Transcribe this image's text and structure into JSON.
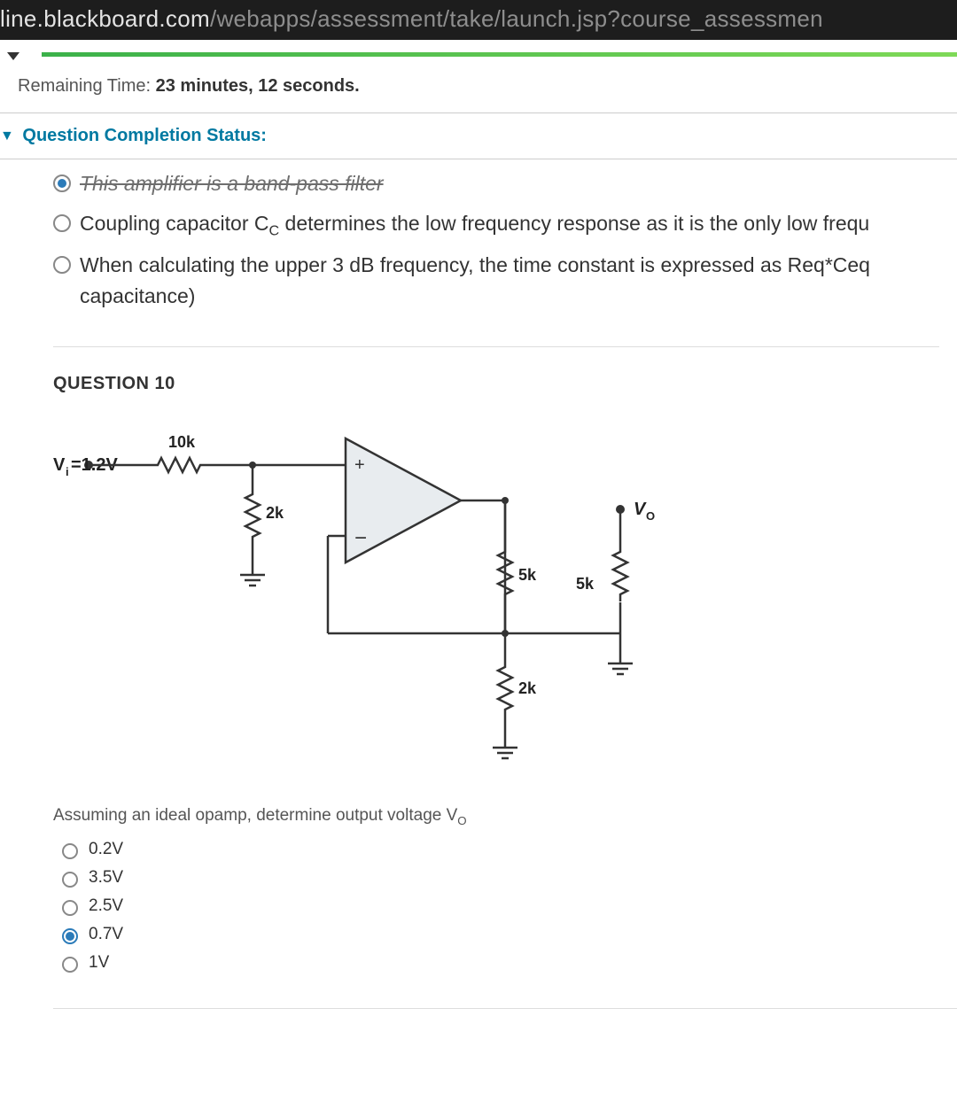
{
  "url": {
    "host": "line.blackboard.com",
    "path": "/webapps/assessment/take/launch.jsp?course_assessmen"
  },
  "timer": {
    "label": "Remaining Time:",
    "value": "23 minutes, 12 seconds."
  },
  "status": {
    "label": "Question Completion Status:"
  },
  "prev_question": {
    "options": [
      {
        "text": "This amplifier is a band-pass filter",
        "selected": true,
        "cutoff": true
      },
      {
        "text": "Coupling capacitor C",
        "sub": "C",
        "text2": " determines the low frequency response as it is the only low frequ",
        "selected": false
      },
      {
        "text": "When calculating the upper 3 dB frequency, the time constant is expressed as Req*Ceq capacitance)",
        "selected": false
      }
    ]
  },
  "question": {
    "header": "QUESTION 10",
    "circuit": {
      "input_label": "V",
      "input_sub": "i",
      "input_eq": "=1.2V",
      "r_top": "10k",
      "r_in_shunt": "2k",
      "r_fb_series": "5k",
      "r_fb_shunt_label": "5k",
      "r_out_series": "2k",
      "output_label": "V",
      "output_sub": "O"
    },
    "prompt": "Assuming an ideal opamp, determine output voltage V",
    "prompt_sub": "O",
    "answers": [
      {
        "label": "0.2V",
        "selected": false
      },
      {
        "label": "3.5V",
        "selected": false
      },
      {
        "label": "2.5V",
        "selected": false
      },
      {
        "label": "0.7V",
        "selected": true
      },
      {
        "label": "1V",
        "selected": false
      }
    ]
  }
}
